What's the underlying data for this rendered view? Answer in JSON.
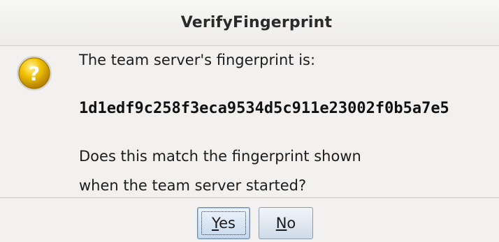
{
  "dialog": {
    "title": "VerifyFingerprint",
    "message_line1": "The team server's fingerprint is:",
    "fingerprint": "1d1edf9c258f3eca9534d5c911e23002f0b5a7e5",
    "question_line1": "Does this match the fingerprint shown",
    "question_line2": "when the team server started?",
    "icon": "question-icon"
  },
  "buttons": {
    "yes_mnemonic": "Y",
    "yes_rest": "es",
    "no_mnemonic": "N",
    "no_rest": "o"
  },
  "colors": {
    "icon_gold": "#e8b400",
    "button_blue": "#c6d9ee",
    "background": "#f2f1f0"
  }
}
